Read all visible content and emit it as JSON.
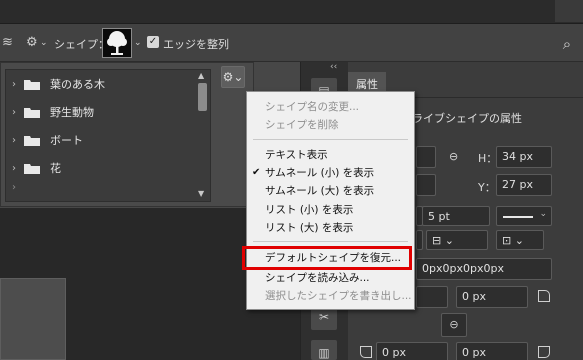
{
  "options_bar": {
    "shape_label": "シェイプ：",
    "align_edges_label": "エッジを整列",
    "align_edges_checked": true
  },
  "shape_list": {
    "items": [
      {
        "label": "葉のある木"
      },
      {
        "label": "野生動物"
      },
      {
        "label": "ボート"
      },
      {
        "label": "花"
      }
    ]
  },
  "properties": {
    "tab_label": "属性",
    "title": "ライブシェイプの属性",
    "h_label": "H：",
    "h_value": "34 px",
    "y_label": "Y：",
    "y_value": "27 px",
    "stroke_width": "5 pt",
    "corner_radius_all": "0px0px0px0px",
    "corner_tr": "0 px",
    "corner_bl": "0 px",
    "corner_br": "0 px"
  },
  "context_menu": {
    "items": [
      {
        "label": "シェイプ名の変更...",
        "enabled": false
      },
      {
        "label": "シェイプを削除",
        "enabled": false
      },
      {
        "label": "テキスト表示",
        "enabled": true
      },
      {
        "label": "サムネール (小) を表示",
        "enabled": true,
        "checked": true
      },
      {
        "label": "サムネール (大) を表示",
        "enabled": true
      },
      {
        "label": "リスト (小) を表示",
        "enabled": true
      },
      {
        "label": "リスト (大) を表示",
        "enabled": true
      },
      {
        "label": "デフォルトシェイプを復元...",
        "enabled": true,
        "highlighted": true
      },
      {
        "label": "シェイプを読み込み...",
        "enabled": true
      },
      {
        "label": "選択したシェイプを書き出し...",
        "enabled": false
      }
    ]
  },
  "colors": {
    "highlight_border": "#e00000",
    "menu_bg": "#f0f0f0"
  }
}
